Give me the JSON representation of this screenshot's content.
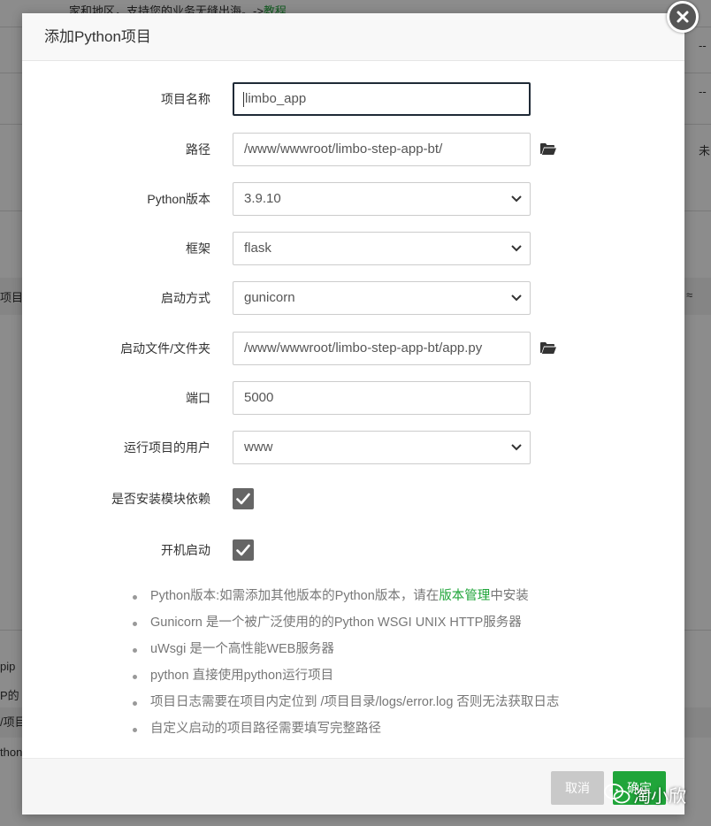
{
  "background": {
    "top_text": "家和地区，支持您的业务无缝出海。->",
    "top_link": "教程",
    "dash_1": "--",
    "dash_2": "--",
    "right_char": "未",
    "left_col": "项目",
    "right_col": "≈",
    "side_1": "pip",
    "side_2": "P的",
    "side_3": "/项目",
    "side_4": "thon"
  },
  "modal": {
    "title": "添加Python项目",
    "close_icon": "close-icon",
    "fields": {
      "project_name": {
        "label": "项目名称",
        "value": "limbo_app"
      },
      "path": {
        "label": "路径",
        "value": "/www/wwwroot/limbo-step-app-bt/",
        "icon": "folder-open-icon"
      },
      "python_version": {
        "label": "Python版本",
        "value": "3.9.10"
      },
      "framework": {
        "label": "框架",
        "value": "flask"
      },
      "startup_mode": {
        "label": "启动方式",
        "value": "gunicorn"
      },
      "startup_file": {
        "label": "启动文件/文件夹",
        "value": "/www/wwwroot/limbo-step-app-bt/app.py",
        "icon": "folder-open-icon"
      },
      "port": {
        "label": "端口",
        "value": "5000"
      },
      "run_user": {
        "label": "运行项目的用户",
        "value": "www"
      },
      "install_deps": {
        "label": "是否安装模块依赖",
        "checked": true
      },
      "autostart": {
        "label": "开机启动",
        "checked": true
      }
    },
    "tips": {
      "t1_before": "Python版本:如需添加其他版本的Python版本，请在",
      "t1_link": "版本管理",
      "t1_after": "中安装",
      "t2": "Gunicorn 是一个被广泛使用的的Python WSGI UNIX HTTP服务器",
      "t3": "uWsgi 是一个高性能WEB服务器",
      "t4": "python 直接使用python运行项目",
      "t5": "项目日志需要在项目内定位到 /项目目录/logs/error.log 否则无法获取日志",
      "t6": "自定义启动的项目路径需要填写完整路径"
    },
    "footer": {
      "cancel_label": "取消",
      "ok_label": "确定"
    }
  },
  "watermark": {
    "text": "淘小欣",
    "icon": "wechat-icon"
  },
  "colors": {
    "accent_green": "#20a53a",
    "cancel_gray": "#c9c9c9",
    "checkbox_gray": "#666666"
  }
}
